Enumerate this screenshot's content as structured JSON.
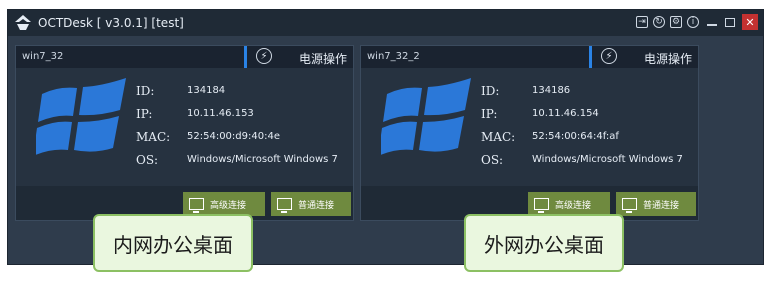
{
  "app": {
    "title": "OCTDesk [ v3.0.1] [test]"
  },
  "window_controls": {
    "icons": [
      "login-icon",
      "refresh-icon",
      "settings-icon",
      "info-icon",
      "minimize-icon",
      "maximize-icon",
      "close-icon"
    ]
  },
  "cards": [
    {
      "hostname": "win7_32",
      "power_label": "电源操作",
      "labels": {
        "id": "ID:",
        "ip": "IP:",
        "mac": "MAC:",
        "os": "OS:"
      },
      "id": "134184",
      "ip": "10.11.46.153",
      "mac": "52:54:00:d9:40:4e",
      "os": "Windows/Microsoft Windows 7",
      "advanced_connect": "高级连接",
      "normal_connect": "普通连接"
    },
    {
      "hostname": "win7_32_2",
      "power_label": "电源操作",
      "labels": {
        "id": "ID:",
        "ip": "IP:",
        "mac": "MAC:",
        "os": "OS:"
      },
      "id": "134186",
      "ip": "10.11.46.154",
      "mac": "52:54:00:64:4f:af",
      "os": "Windows/Microsoft Windows 7",
      "advanced_connect": "高级连接",
      "normal_connect": "普通连接"
    }
  ],
  "callouts": {
    "intranet": "内网办公桌面",
    "extranet": "外网办公桌面"
  },
  "colors": {
    "window_bg": "#2f3c4c",
    "titlebar_bg": "#1f2a36",
    "card_bg": "#263240",
    "accent_blue": "#2a83e6",
    "windows_logo_blue": "#2b78d8",
    "action_button_green": "#6f8a3f",
    "callout_bg": "#eaf7df",
    "callout_border": "#8cc063",
    "close_button_red": "#c43131"
  }
}
